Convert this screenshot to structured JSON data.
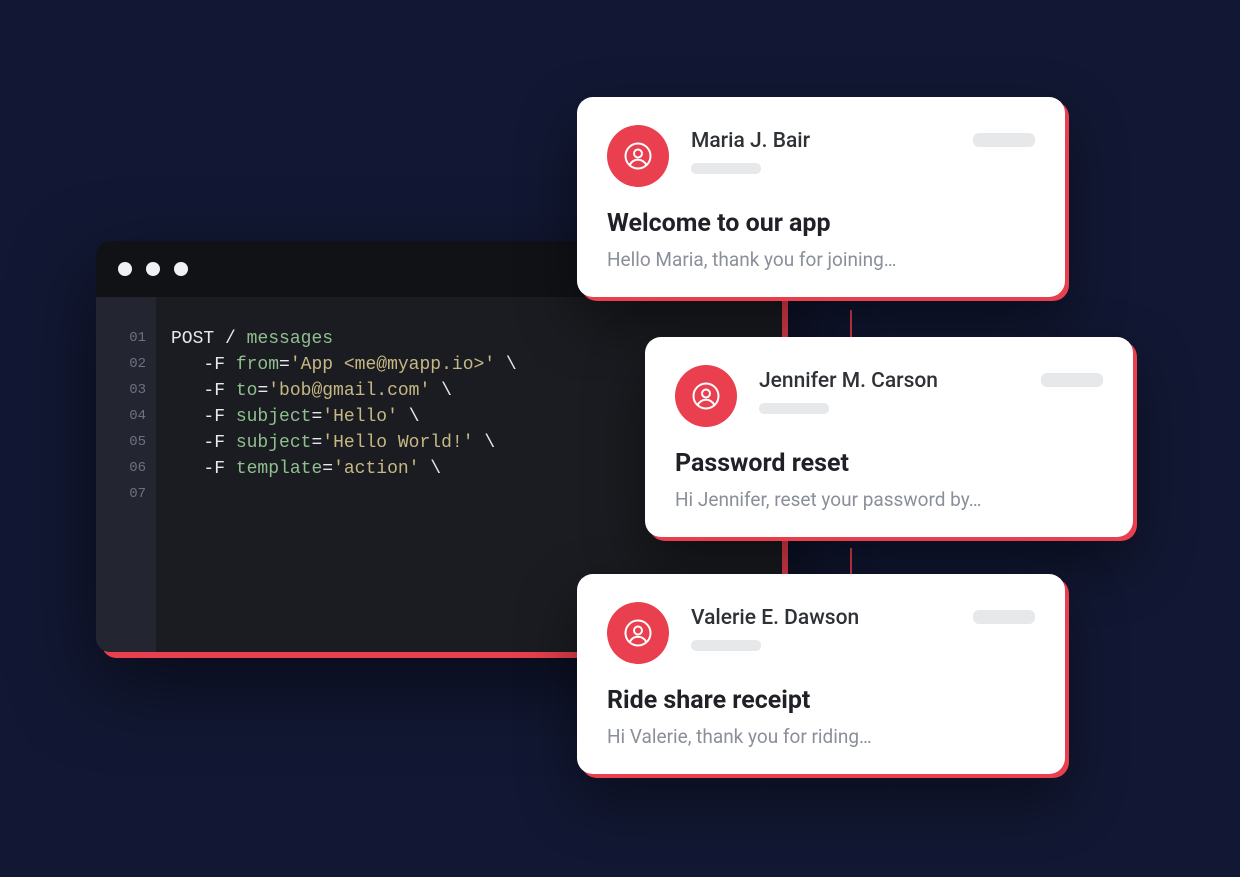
{
  "code": {
    "line_numbers": [
      "01",
      "02",
      "03",
      "04",
      "05",
      "06",
      "07"
    ],
    "post": "POST",
    "path": "messages",
    "params": [
      {
        "key": "from",
        "value": "'App <me@myapp.io>'"
      },
      {
        "key": "to",
        "value": "'bob@gmail.com'"
      },
      {
        "key": "subject",
        "value": "'Hello'"
      },
      {
        "key": "subject",
        "value": "'Hello World!'"
      },
      {
        "key": "template",
        "value": "'action'"
      }
    ]
  },
  "cards": [
    {
      "sender": "Maria J. Bair",
      "subject": "Welcome to our app",
      "preview": "Hello Maria, thank you for joining…"
    },
    {
      "sender": "Jennifer M. Carson",
      "subject": "Password reset",
      "preview": "Hi Jennifer, reset your password by…"
    },
    {
      "sender": "Valerie E. Dawson",
      "subject": "Ride share receipt",
      "preview": "Hi Valerie, thank you for riding…"
    }
  ],
  "colors": {
    "accent": "#e93f4e",
    "bg": "#121833"
  }
}
